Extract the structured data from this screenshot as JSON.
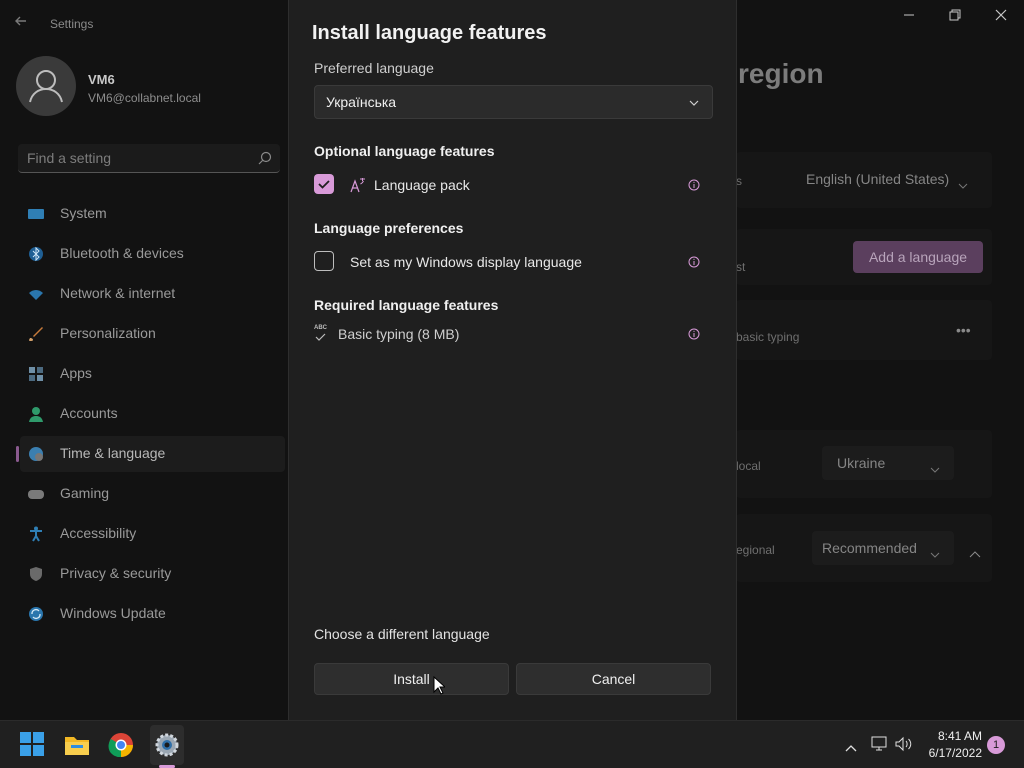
{
  "settings": {
    "title": "Settings",
    "user": {
      "name": "VM6",
      "email": "VM6@collabnet.local"
    },
    "search_placeholder": "Find a setting",
    "nav": [
      {
        "label": "System"
      },
      {
        "label": "Bluetooth & devices"
      },
      {
        "label": "Network & internet"
      },
      {
        "label": "Personalization"
      },
      {
        "label": "Apps"
      },
      {
        "label": "Accounts"
      },
      {
        "label": "Time & language"
      },
      {
        "label": "Gaming"
      },
      {
        "label": "Accessibility"
      },
      {
        "label": "Privacy & security"
      },
      {
        "label": "Windows Update"
      }
    ],
    "heading_fragment": "region",
    "background": {
      "display_lang_value": "English (United States)",
      "row2_fragment": "st",
      "add_language": "Add a language",
      "row3_fragment": "basic typing",
      "row4_fragment": "local",
      "country_value": "Ukraine",
      "row5_fragment": "egional",
      "format_value": "Recommended",
      "row1_fragment": "s"
    }
  },
  "dialog": {
    "title": "Install language features",
    "preferred_label": "Preferred language",
    "preferred_value": "Українська",
    "optional_heading": "Optional language features",
    "language_pack": "Language pack",
    "preferences_heading": "Language preferences",
    "display_language": "Set as my Windows display language",
    "required_heading": "Required language features",
    "basic_typing": "Basic typing (8 MB)",
    "abc_label": "ABC",
    "choose_link": "Choose a different language",
    "install": "Install",
    "cancel": "Cancel",
    "language_pack_checked": true,
    "display_language_checked": false
  },
  "taskbar": {
    "time": "8:41 AM",
    "date": "6/17/2022",
    "notifications": "1"
  },
  "colors": {
    "accent": "#d89ad8",
    "dialog_bg": "#1f1f1f",
    "window_bg": "#121212"
  }
}
